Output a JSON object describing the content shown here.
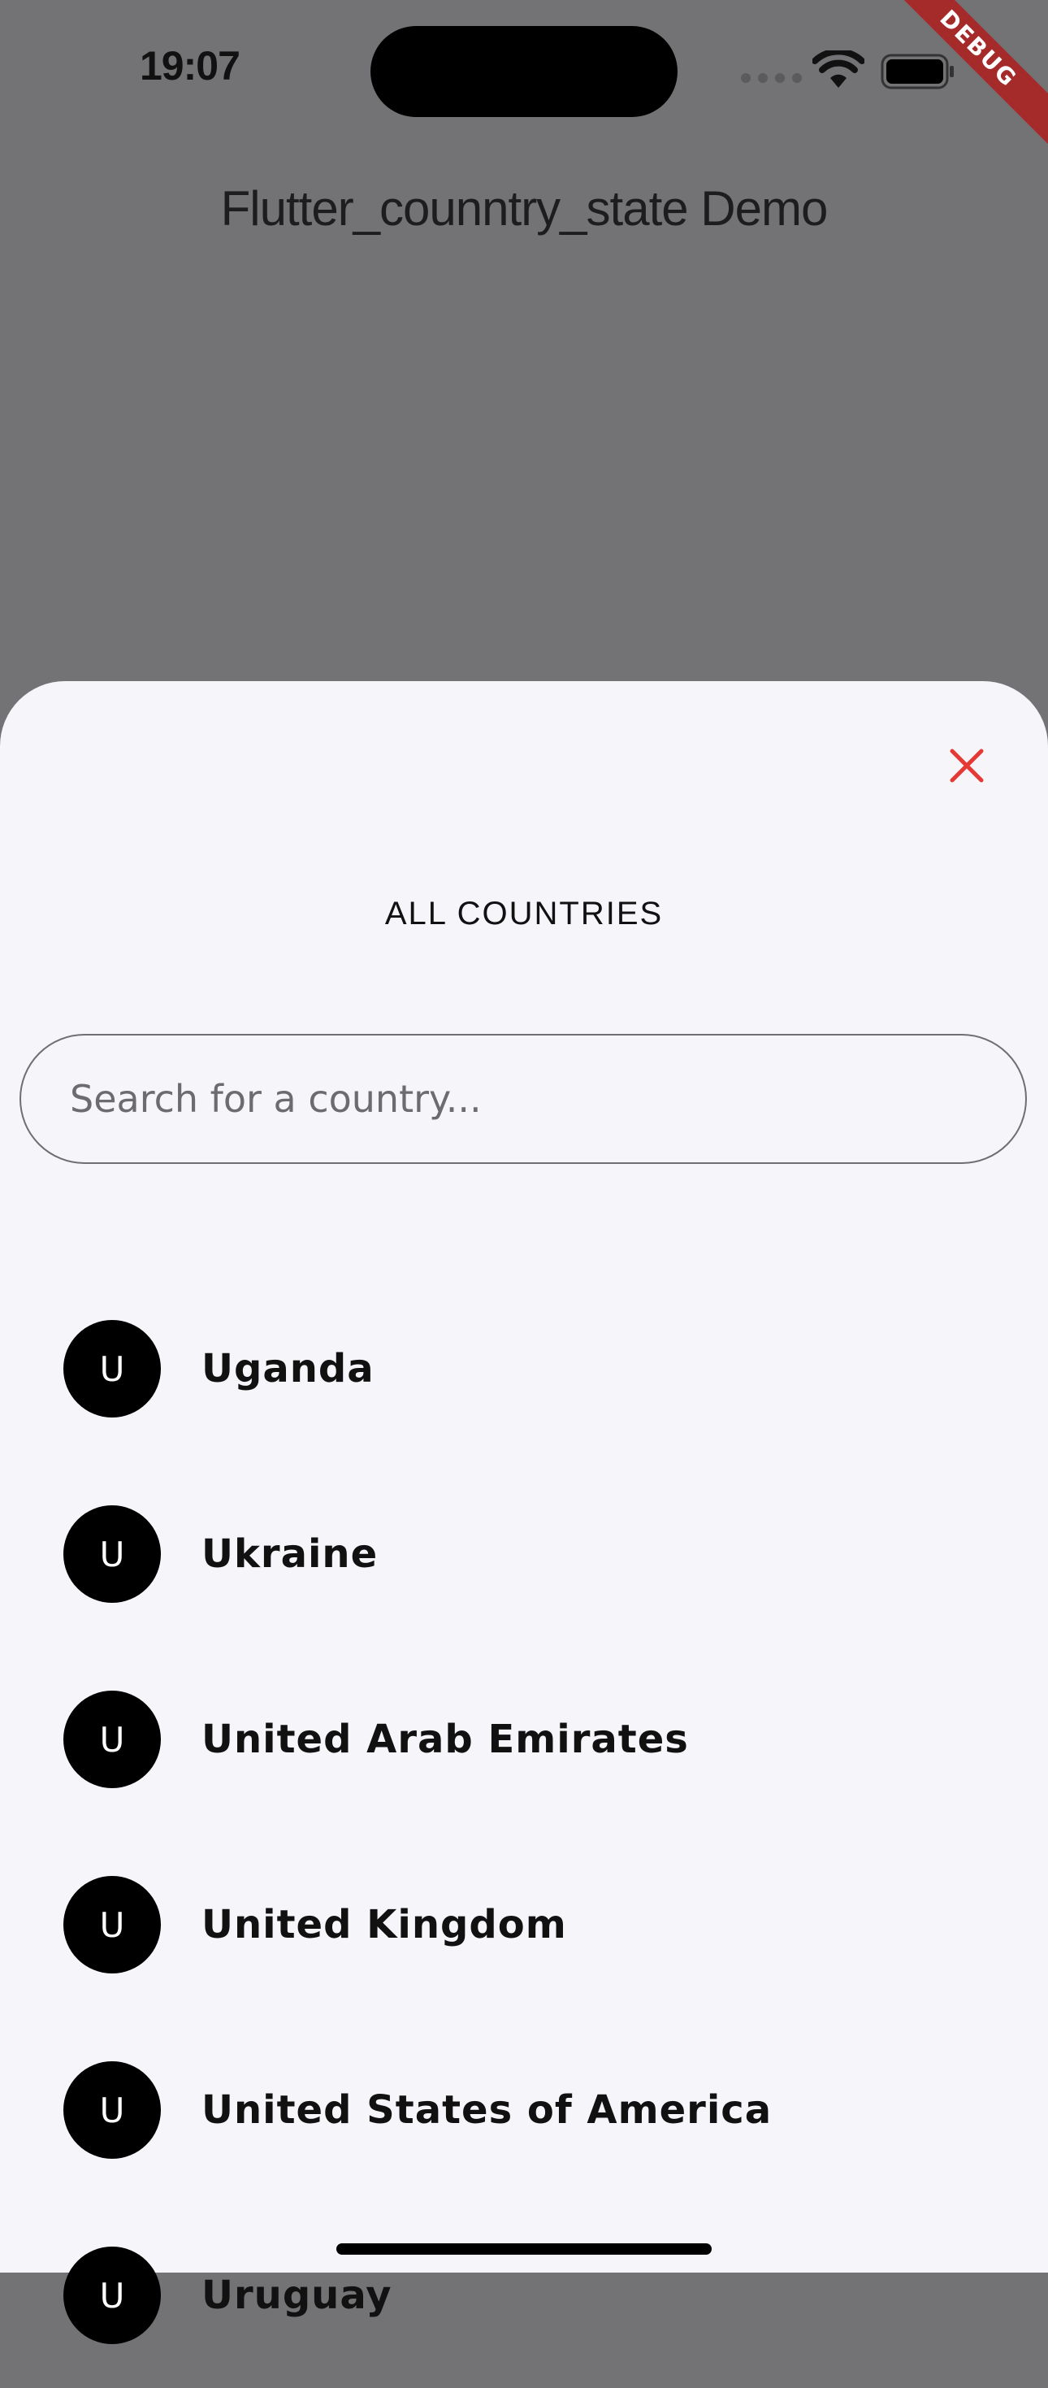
{
  "status_bar": {
    "time": "19:07",
    "icons": [
      "cellular-dots-icon",
      "wifi-icon",
      "battery-icon"
    ]
  },
  "debug_banner": "DEBUG",
  "app": {
    "title": "Flutter_counntry_state Demo"
  },
  "sheet": {
    "close_icon": "close-icon",
    "close_color": "#e53935",
    "title": "ALL COUNTRIES",
    "search": {
      "placeholder": "Search for a country...",
      "value": ""
    },
    "countries": [
      {
        "initial": "U",
        "name": "Uganda"
      },
      {
        "initial": "U",
        "name": "Ukraine"
      },
      {
        "initial": "U",
        "name": "United Arab Emirates"
      },
      {
        "initial": "U",
        "name": "United Kingdom"
      },
      {
        "initial": "U",
        "name": "United States of America"
      },
      {
        "initial": "U",
        "name": "Uruguay"
      }
    ]
  },
  "colors": {
    "overlay_background": "#737275",
    "sheet_background": "#f5f5fa",
    "avatar_background": "#000000",
    "debug_banner": "#a52a2a"
  }
}
